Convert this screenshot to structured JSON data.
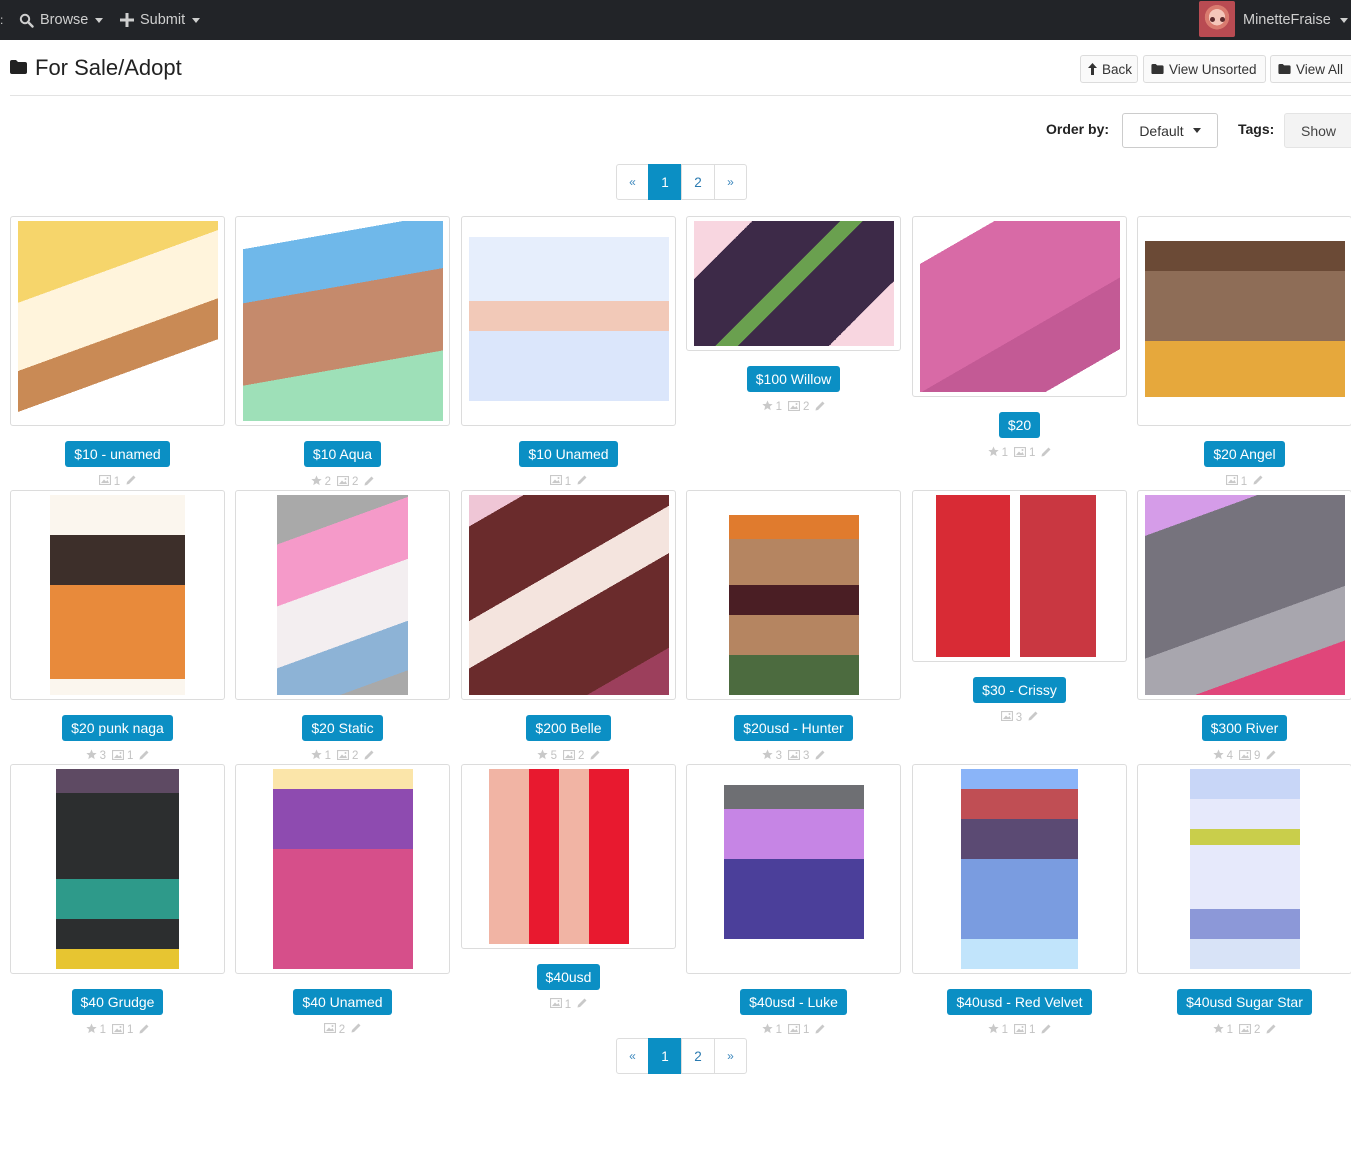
{
  "nav": {
    "browse_label": "Browse",
    "submit_label": "Submit",
    "username": "MinetteFraise"
  },
  "header": {
    "title": "For Sale/Adopt",
    "back_label": "Back",
    "view_unsorted_label": "View Unsorted",
    "view_all_label": "View All"
  },
  "filters": {
    "order_by_label": "Order by:",
    "order_by_value": "Default",
    "tags_label": "Tags:",
    "tags_show_label": "Show"
  },
  "pagination": {
    "prev": "«",
    "next": "»",
    "pages": [
      "1",
      "2"
    ],
    "current": "1"
  },
  "items": [
    {
      "label": "$10 - unamed",
      "favorites": null,
      "images": "1",
      "icon": "art-thumbnail"
    },
    {
      "label": "$10 Aqua",
      "favorites": "2",
      "images": "2",
      "icon": "art-thumbnail"
    },
    {
      "label": "$10 Unamed",
      "favorites": null,
      "images": "1",
      "icon": "art-thumbnail"
    },
    {
      "label": "$100 Willow",
      "favorites": "1",
      "images": "2",
      "icon": "art-thumbnail"
    },
    {
      "label": "$20",
      "favorites": "1",
      "images": "1",
      "icon": "art-thumbnail"
    },
    {
      "label": "$20 Angel",
      "favorites": null,
      "images": "1",
      "icon": "art-thumbnail"
    },
    {
      "label": "$20 punk naga",
      "favorites": "3",
      "images": "1",
      "icon": "art-thumbnail"
    },
    {
      "label": "$20 Static",
      "favorites": "1",
      "images": "2",
      "icon": "art-thumbnail"
    },
    {
      "label": "$200 Belle",
      "favorites": "5",
      "images": "2",
      "icon": "art-thumbnail"
    },
    {
      "label": "$20usd - Hunter",
      "favorites": "3",
      "images": "3",
      "icon": "art-thumbnail"
    },
    {
      "label": "$30 - Crissy",
      "favorites": null,
      "images": "3",
      "icon": "art-thumbnail"
    },
    {
      "label": "$300 River",
      "favorites": "4",
      "images": "9",
      "icon": "art-thumbnail"
    },
    {
      "label": "$40 Grudge",
      "favorites": "1",
      "images": "1",
      "icon": "art-thumbnail"
    },
    {
      "label": "$40 Unamed",
      "favorites": null,
      "images": "2",
      "icon": "art-thumbnail"
    },
    {
      "label": "$40usd",
      "favorites": null,
      "images": "1",
      "icon": "art-thumbnail"
    },
    {
      "label": "$40usd - Luke",
      "favorites": "1",
      "images": "1",
      "icon": "art-thumbnail"
    },
    {
      "label": "$40usd - Red Velvet",
      "favorites": "1",
      "images": "1",
      "icon": "art-thumbnail"
    },
    {
      "label": "$40usd Sugar Star",
      "favorites": "1",
      "images": "2",
      "icon": "art-thumbnail"
    }
  ],
  "colors": {
    "navbar": "#222428",
    "accent": "#0b8fc4",
    "link": "#2a7ab0",
    "muted": "#c2c2c2"
  }
}
